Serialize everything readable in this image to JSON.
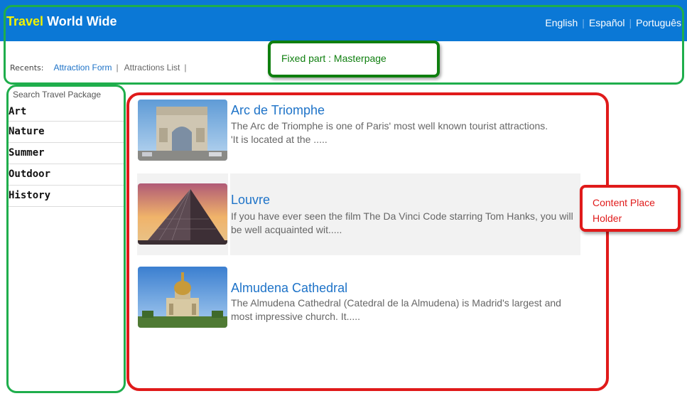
{
  "header": {
    "logo_part1": "Travel",
    "logo_part2": "World Wide",
    "languages": [
      "English",
      "Español",
      "Português"
    ],
    "bg_color": "#0b78d6",
    "logo_accent_color": "#f2f200"
  },
  "recents": {
    "label": "Recents:",
    "links": [
      "Attraction Form",
      "Attractions List"
    ]
  },
  "annotations": {
    "masterpage_note": "Fixed part : Masterpage",
    "content_note": "Content Place Holder",
    "green_color": "#1fae4c",
    "red_color": "#e01a1a"
  },
  "sidebar": {
    "search_placeholder": "Search Travel Package",
    "categories": [
      "Art",
      "Nature",
      "Summer",
      "Outdoor",
      "History"
    ]
  },
  "attractions": [
    {
      "title": "Arc de Triomphe",
      "description": "The Arc de Triomphe is one of Paris' most well known tourist attractions.\n'It is located at the .....",
      "image": "arc-de-triomphe-photo"
    },
    {
      "title": "Louvre",
      "description": "If you have ever seen the film The Da Vinci Code starring Tom Hanks, you will be well acquainted wit.....",
      "image": "louvre-pyramid-photo"
    },
    {
      "title": "Almudena Cathedral",
      "description": "The Almudena Cathedral (Catedral de la Almudena) is Madrid's largest and most impressive church. It.....",
      "image": "almudena-cathedral-photo"
    }
  ]
}
